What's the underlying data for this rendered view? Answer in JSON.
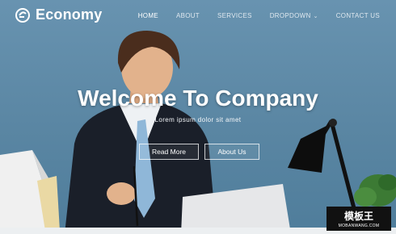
{
  "nav": {
    "brand": "Economy",
    "items": [
      {
        "label": "HOME",
        "active": true
      },
      {
        "label": "ABOUT",
        "active": false
      },
      {
        "label": "SERVICES",
        "active": false
      },
      {
        "label": "DROPDOWN",
        "active": false
      },
      {
        "label": "CONTACT US",
        "active": false
      }
    ]
  },
  "hero": {
    "title": "Welcome To Company",
    "subtitle": "Lorem ipsum dolor sit amet",
    "buttons": {
      "read_more": "Read More",
      "about_us": "About Us"
    }
  },
  "watermark": {
    "top": "模板王",
    "bottom": "MOBANWANG.COM"
  },
  "colors": {
    "background": "#5b87a5",
    "text": "#ffffff"
  }
}
